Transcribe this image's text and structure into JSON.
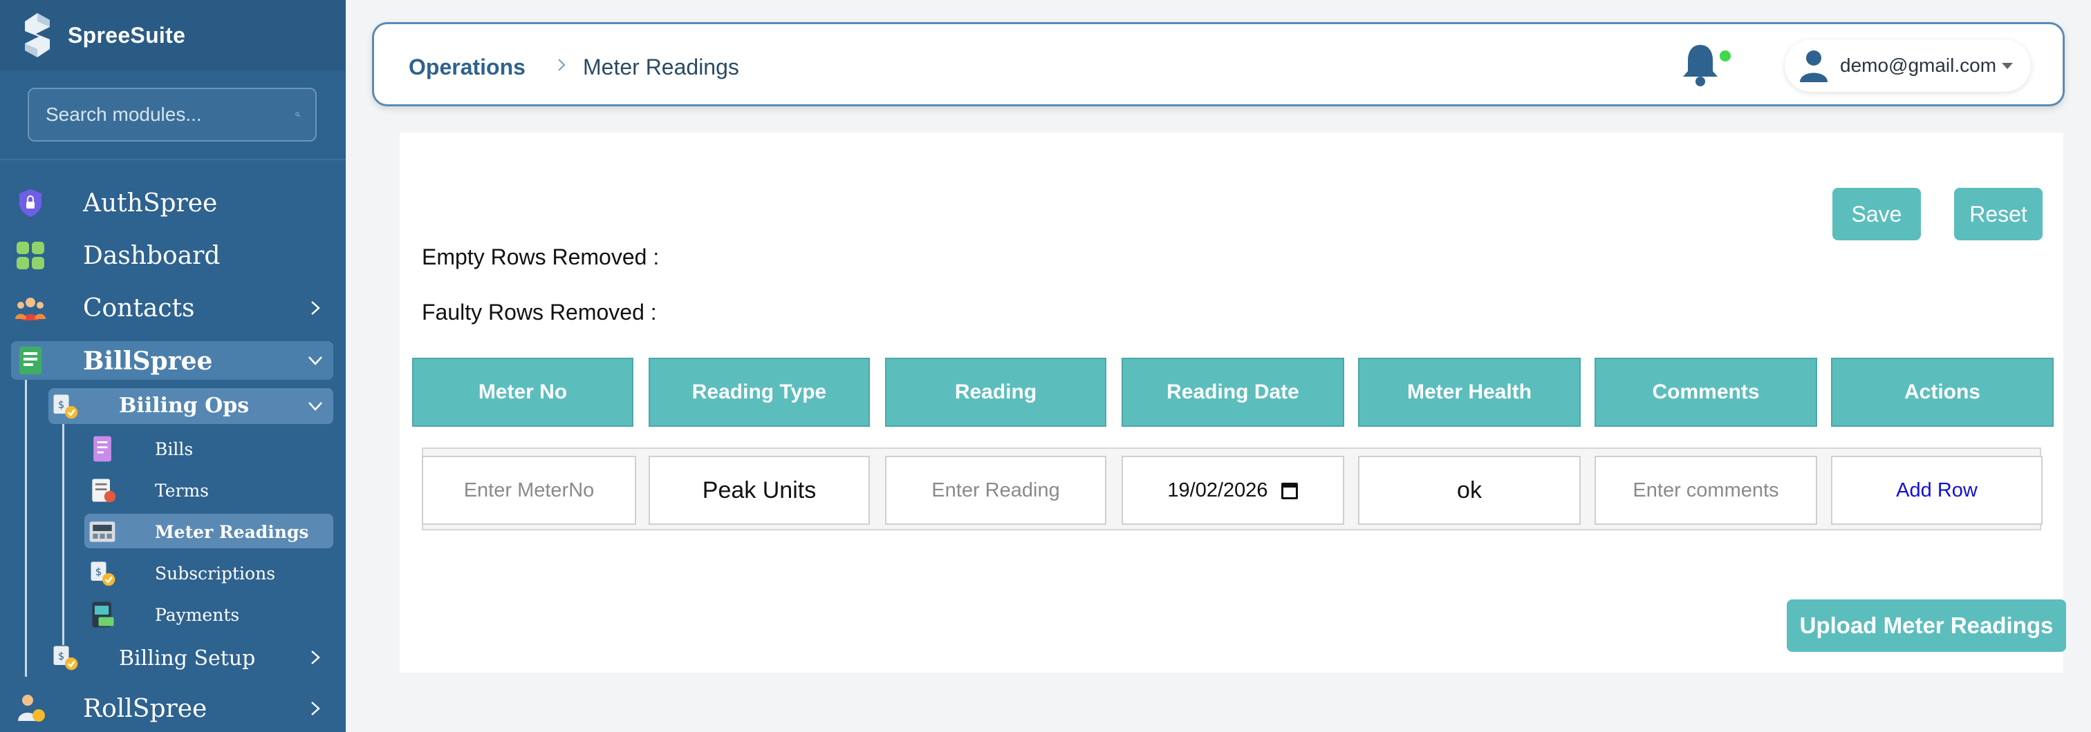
{
  "app": {
    "name": "SpreeSuite"
  },
  "sidebar": {
    "search_placeholder": "Search modules...",
    "items": [
      {
        "label": "AuthSpree",
        "icon": "shield-lock-icon"
      },
      {
        "label": "Dashboard",
        "icon": "grid-icon"
      },
      {
        "label": "Contacts",
        "icon": "people-icon"
      },
      {
        "label": "BillSpree",
        "icon": "ledger-icon"
      },
      {
        "label": "Biiling Ops",
        "icon": "billing-ops-icon"
      },
      {
        "label": "Bills",
        "icon": "invoice-icon"
      },
      {
        "label": "Terms",
        "icon": "terms-icon"
      },
      {
        "label": "Meter Readings",
        "icon": "meter-icon"
      },
      {
        "label": "Subscriptions",
        "icon": "subscription-icon"
      },
      {
        "label": "Payments",
        "icon": "payment-icon"
      },
      {
        "label": "Billing Setup",
        "icon": "billing-setup-icon"
      },
      {
        "label": "RollSpree",
        "icon": "payroll-icon"
      }
    ]
  },
  "header": {
    "breadcrumb_section": "Operations",
    "breadcrumb_page": "Meter Readings",
    "user_email": "demo@gmail.com"
  },
  "content": {
    "save_label": "Save",
    "reset_label": "Reset",
    "empty_rows_label": "Empty Rows Removed :",
    "faulty_rows_label": "Faulty Rows Removed :",
    "columns": [
      "Meter No",
      "Reading Type",
      "Reading",
      "Reading Date",
      "Meter Health",
      "Comments",
      "Actions"
    ],
    "row": {
      "meter_no_placeholder": "Enter MeterNo",
      "reading_type": "Peak Units",
      "reading_placeholder": "Enter Reading",
      "reading_date": "19/02/2026",
      "meter_health": "ok",
      "comments_placeholder": "Enter comments",
      "action": "Add Row"
    },
    "upload_label": "Upload Meter Readings"
  },
  "colors": {
    "sidebar": "#2e628f",
    "accent": "#5cbdbd",
    "link": "#1010d6",
    "notification_dot": "#3fd94a"
  }
}
